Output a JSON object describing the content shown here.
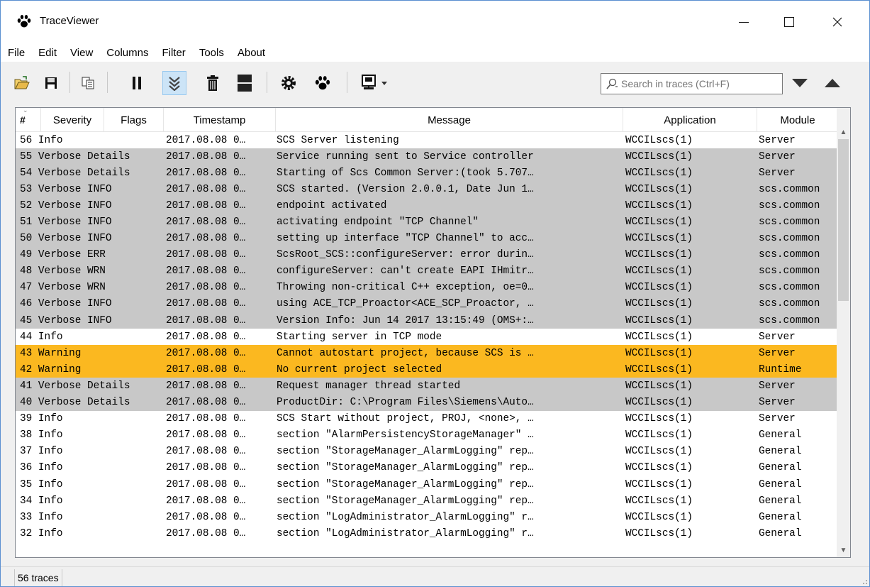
{
  "window": {
    "title": "TraceViewer"
  },
  "menu": [
    "File",
    "Edit",
    "View",
    "Columns",
    "Filter",
    "Tools",
    "About"
  ],
  "toolbar": {
    "search_placeholder": "Search in traces (Ctrl+F)"
  },
  "table": {
    "headers": {
      "id": "#",
      "severity": "Severity",
      "flags": "Flags",
      "timestamp": "Timestamp",
      "message": "Message",
      "application": "Application",
      "module": "Module"
    },
    "rows": [
      {
        "id": "56",
        "severity": "Info",
        "flags": "",
        "timestamp": "2017.08.08 0…",
        "message": "SCS Server listening",
        "application": "WCCILscs(1)",
        "module": "Server",
        "style": "normal"
      },
      {
        "id": "55",
        "severity": "Verbose",
        "flags": "Details",
        "timestamp": "2017.08.08 0…",
        "message": "Service running sent to Service controller",
        "application": "WCCILscs(1)",
        "module": "Server",
        "style": "sel"
      },
      {
        "id": "54",
        "severity": "Verbose",
        "flags": "Details",
        "timestamp": "2017.08.08 0…",
        "message": "Starting of Scs Common Server:(took 5.707…",
        "application": "WCCILscs(1)",
        "module": "Server",
        "style": "sel"
      },
      {
        "id": "53",
        "severity": "Verbose",
        "flags": "INFO",
        "timestamp": "2017.08.08 0…",
        "message": "SCS started. (Version 2.0.0.1, Date Jun 1…",
        "application": "WCCILscs(1)",
        "module": "scs.common",
        "style": "sel"
      },
      {
        "id": "52",
        "severity": "Verbose",
        "flags": "INFO",
        "timestamp": "2017.08.08 0…",
        "message": "endpoint activated",
        "application": "WCCILscs(1)",
        "module": "scs.common",
        "style": "sel"
      },
      {
        "id": "51",
        "severity": "Verbose",
        "flags": "INFO",
        "timestamp": "2017.08.08 0…",
        "message": "activating endpoint \"TCP Channel\"",
        "application": "WCCILscs(1)",
        "module": "scs.common",
        "style": "sel"
      },
      {
        "id": "50",
        "severity": "Verbose",
        "flags": "INFO",
        "timestamp": "2017.08.08 0…",
        "message": "setting up interface \"TCP Channel\" to acc…",
        "application": "WCCILscs(1)",
        "module": "scs.common",
        "style": "sel"
      },
      {
        "id": "49",
        "severity": "Verbose",
        "flags": "ERR",
        "timestamp": "2017.08.08 0…",
        "message": "ScsRoot_SCS::configureServer: error durin…",
        "application": "WCCILscs(1)",
        "module": "scs.common",
        "style": "sel"
      },
      {
        "id": "48",
        "severity": "Verbose",
        "flags": "WRN",
        "timestamp": "2017.08.08 0…",
        "message": "configureServer: can't create EAPI IHmitr…",
        "application": "WCCILscs(1)",
        "module": "scs.common",
        "style": "sel"
      },
      {
        "id": "47",
        "severity": "Verbose",
        "flags": "WRN",
        "timestamp": "2017.08.08 0…",
        "message": "Throwing non-critical C++ exception, oe=0…",
        "application": "WCCILscs(1)",
        "module": "scs.common",
        "style": "sel"
      },
      {
        "id": "46",
        "severity": "Verbose",
        "flags": "INFO",
        "timestamp": "2017.08.08 0…",
        "message": "using ACE_TCP_Proactor<ACE_SCP_Proactor, …",
        "application": "WCCILscs(1)",
        "module": "scs.common",
        "style": "sel"
      },
      {
        "id": "45",
        "severity": "Verbose",
        "flags": "INFO",
        "timestamp": "2017.08.08 0…",
        "message": "Version Info: Jun 14 2017 13:15:49 (OMS+:…",
        "application": "WCCILscs(1)",
        "module": "scs.common",
        "style": "sel"
      },
      {
        "id": "44",
        "severity": "Info",
        "flags": "",
        "timestamp": "2017.08.08 0…",
        "message": "Starting server in TCP mode",
        "application": "WCCILscs(1)",
        "module": "Server",
        "style": "normal"
      },
      {
        "id": "43",
        "severity": "Warning",
        "flags": "",
        "timestamp": "2017.08.08 0…",
        "message": "Cannot autostart project, because SCS is …",
        "application": "WCCILscs(1)",
        "module": "Server",
        "style": "warn"
      },
      {
        "id": "42",
        "severity": "Warning",
        "flags": "",
        "timestamp": "2017.08.08 0…",
        "message": "No current project selected",
        "application": "WCCILscs(1)",
        "module": "Runtime",
        "style": "warn"
      },
      {
        "id": "41",
        "severity": "Verbose",
        "flags": "Details",
        "timestamp": "2017.08.08 0…",
        "message": "Request manager thread started",
        "application": "WCCILscs(1)",
        "module": "Server",
        "style": "sel"
      },
      {
        "id": "40",
        "severity": "Verbose",
        "flags": "Details",
        "timestamp": "2017.08.08 0…",
        "message": "ProductDir: C:\\Program Files\\Siemens\\Auto…",
        "application": "WCCILscs(1)",
        "module": "Server",
        "style": "sel"
      },
      {
        "id": "39",
        "severity": "Info",
        "flags": "",
        "timestamp": "2017.08.08 0…",
        "message": "SCS Start without project, PROJ, <none>, …",
        "application": "WCCILscs(1)",
        "module": "Server",
        "style": "normal"
      },
      {
        "id": "38",
        "severity": "Info",
        "flags": "",
        "timestamp": "2017.08.08 0…",
        "message": "section \"AlarmPersistencyStorageManager\" …",
        "application": "WCCILscs(1)",
        "module": "General",
        "style": "normal"
      },
      {
        "id": "37",
        "severity": "Info",
        "flags": "",
        "timestamp": "2017.08.08 0…",
        "message": "section \"StorageManager_AlarmLogging\" rep…",
        "application": "WCCILscs(1)",
        "module": "General",
        "style": "normal"
      },
      {
        "id": "36",
        "severity": "Info",
        "flags": "",
        "timestamp": "2017.08.08 0…",
        "message": "section \"StorageManager_AlarmLogging\" rep…",
        "application": "WCCILscs(1)",
        "module": "General",
        "style": "normal"
      },
      {
        "id": "35",
        "severity": "Info",
        "flags": "",
        "timestamp": "2017.08.08 0…",
        "message": "section \"StorageManager_AlarmLogging\" rep…",
        "application": "WCCILscs(1)",
        "module": "General",
        "style": "normal"
      },
      {
        "id": "34",
        "severity": "Info",
        "flags": "",
        "timestamp": "2017.08.08 0…",
        "message": "section \"StorageManager_AlarmLogging\" rep…",
        "application": "WCCILscs(1)",
        "module": "General",
        "style": "normal"
      },
      {
        "id": "33",
        "severity": "Info",
        "flags": "",
        "timestamp": "2017.08.08 0…",
        "message": "section \"LogAdministrator_AlarmLogging\" r…",
        "application": "WCCILscs(1)",
        "module": "General",
        "style": "normal"
      },
      {
        "id": "32",
        "severity": "Info",
        "flags": "",
        "timestamp": "2017.08.08 0…",
        "message": "section \"LogAdministrator_AlarmLogging\" r…",
        "application": "WCCILscs(1)",
        "module": "General",
        "style": "normal"
      }
    ]
  },
  "status": {
    "count_text": "56 traces"
  },
  "colors": {
    "selected_row": "#c8c8c8",
    "warning_row": "#fbb820",
    "active_button": "#cce4f7"
  },
  "icons": [
    "paw-icon",
    "open-folder-icon",
    "save-icon",
    "copy-icon",
    "pause-icon",
    "autoscroll-icon",
    "trash-icon",
    "split-view-icon",
    "settings-gear-icon",
    "paw-icon",
    "monitor-icon",
    "search-icon",
    "find-next-down-icon",
    "find-prev-up-icon"
  ]
}
